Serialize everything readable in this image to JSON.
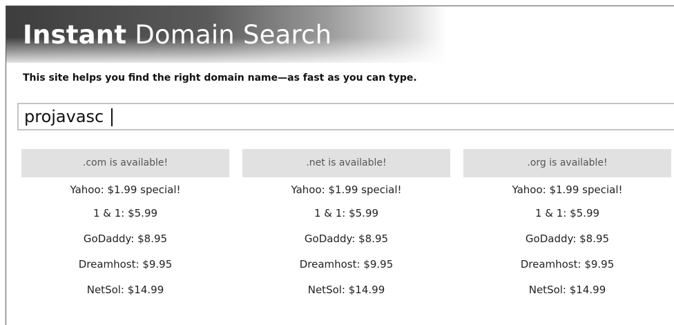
{
  "header": {
    "title_strong": "Instant",
    "title_rest": "Domain Search"
  },
  "tagline": "This site helps you find the right domain name—as fast as you can type.",
  "search": {
    "value": "projavasc"
  },
  "results": [
    {
      "status": ".com is available!",
      "offers": [
        "Yahoo: $1.99 special!",
        "1 & 1: $5.99",
        "GoDaddy: $8.95",
        "Dreamhost: $9.95",
        "NetSol: $14.99"
      ]
    },
    {
      "status": ".net is available!",
      "offers": [
        "Yahoo: $1.99 special!",
        "1 & 1: $5.99",
        "GoDaddy: $8.95",
        "Dreamhost: $9.95",
        "NetSol: $14.99"
      ]
    },
    {
      "status": ".org is available!",
      "offers": [
        "Yahoo: $1.99 special!",
        "1 & 1: $5.99",
        "GoDaddy: $8.95",
        "Dreamhost: $9.95",
        "NetSol: $14.99"
      ]
    }
  ],
  "colors": {
    "header_dark": "#3d3d3d",
    "status_bg": "#e1e1e1",
    "input_border": "#c4c4c4"
  }
}
